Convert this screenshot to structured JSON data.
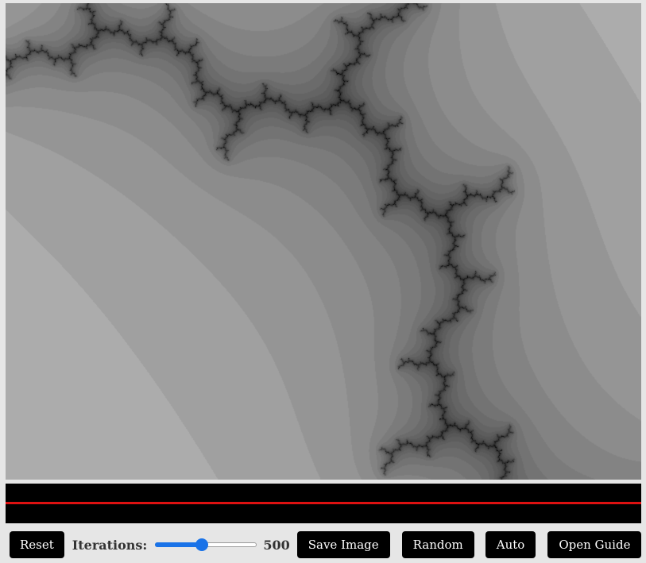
{
  "controls": {
    "reset_label": "Reset",
    "iterations_label": "Iterations:",
    "iterations_value": "500",
    "iterations_fraction": 0.45,
    "save_label": "Save Image",
    "random_label": "Random",
    "auto_label": "Auto",
    "guide_label": "Open Guide"
  },
  "colors": {
    "canvas_background": "#efefef",
    "fractal_ink": "#000000",
    "palette_strip": "#000000",
    "palette_line": "#dd1111",
    "slider_accent": "#1a73e8",
    "button_background": "#000000",
    "button_text": "#ffffff"
  }
}
